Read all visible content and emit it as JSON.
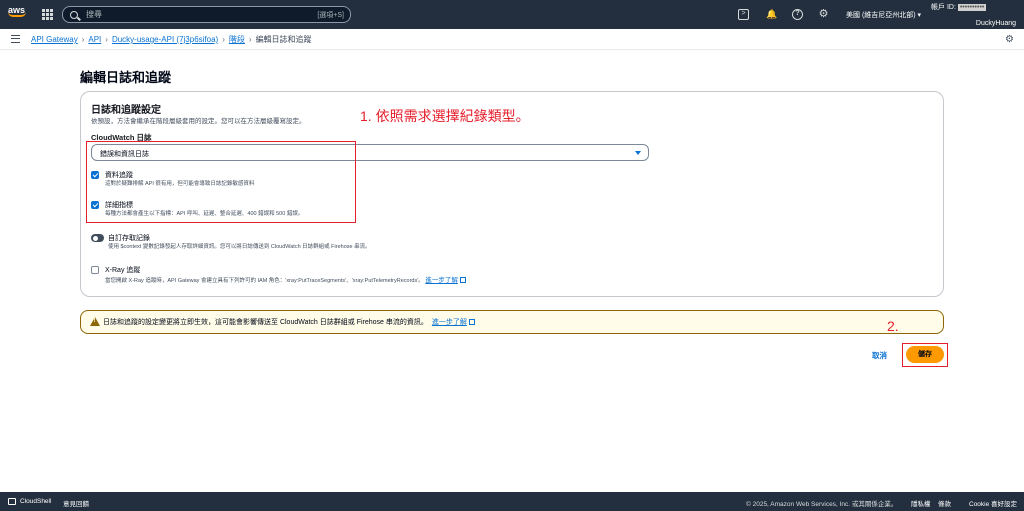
{
  "topnav": {
    "logo": "aws",
    "search_placeholder": "搜尋",
    "search_shortcut": "[選項+S]",
    "region": "美國 (維吉尼亞州北部) ▾",
    "account_label": "帳戶 ID: ",
    "username": "DuckyHuang"
  },
  "breadcrumb": {
    "items": [
      "API Gateway",
      "API",
      "Ducky-usage-API (7j3p6sifoa)",
      "階段"
    ],
    "current": "編輯日誌和追蹤"
  },
  "page": {
    "title": "編輯日誌和追蹤"
  },
  "panel": {
    "title": "日誌和追蹤設定",
    "description": "依預設，方法會繼承在階段層級套用的設定。您可以在方法層級覆寫設定。",
    "cloudwatch_label": "CloudWatch 日誌",
    "cloudwatch_selected": "錯誤和資訊日誌",
    "data_trace": {
      "title": "資料追蹤",
      "desc": "這對於疑難排解 API 很有用，但可能會導致日誌記錄敏感資料",
      "checked": true
    },
    "detailed_metrics": {
      "title": "詳細指標",
      "desc": "每種方法都會產生以下指標：API 呼叫、延遲、整合延遲、400 錯誤和 500 錯誤。",
      "checked": true
    },
    "custom_access_logging": {
      "title": "自訂存取記錄",
      "desc": "使用 $context 變數記錄發起人存取詳細資訊。您可以將日誌傳送到 CloudWatch 日誌群組或 Firehose 串流。",
      "enabled": false
    },
    "xray": {
      "title": "X-Ray 追蹤",
      "desc": "當您開啟 X-Ray 追蹤時，API Gateway 會建立具有下列許可的 IAM 角色：'xray:PutTraceSegments'、'xray:PutTelemetryRecords'。",
      "link": "進一步了解",
      "checked": false
    }
  },
  "annotations": {
    "step1": "1. 依照需求選擇紀錄類型。",
    "step2": "2."
  },
  "warning": {
    "text": "日誌和追蹤的設定變更將立即生效，這可能會影響傳送至 CloudWatch 日誌群組或 Firehose 串流的資訊。",
    "link": "進一步了解"
  },
  "actions": {
    "cancel": "取消",
    "save": "儲存"
  },
  "footer": {
    "cloudshell": "CloudShell",
    "feedback": "意見回饋",
    "copyright": "© 2025, Amazon Web Services, Inc. 或其關係企業。",
    "privacy": "隱私權",
    "terms": "條款",
    "cookie": "Cookie 喜好設定"
  },
  "colors": {
    "nav_bg": "#232f3e",
    "link": "#0972d3",
    "primary_button": "#ff9900",
    "annotation_red": "#e5202d",
    "warning_border": "#8d6605"
  }
}
